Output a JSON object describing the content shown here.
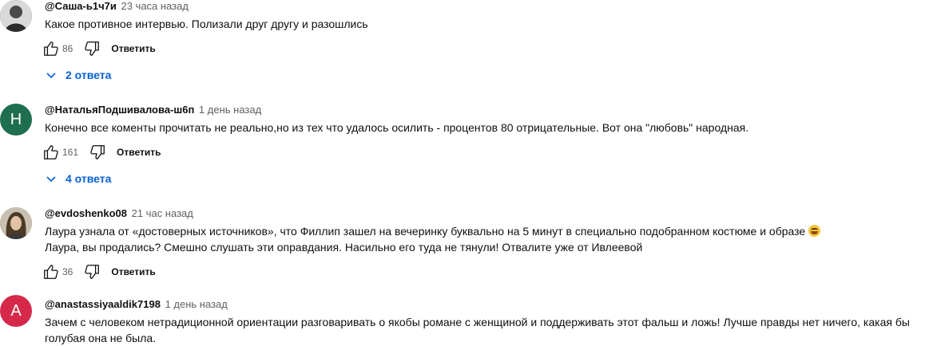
{
  "comments": [
    {
      "author": "@Саша-ь1ч7и",
      "time": "23 часа назад",
      "lines": [
        "Какое противное интервью. Полизали друг другу и разошлись"
      ],
      "likes": "86",
      "reply_label": "Ответить",
      "replies": "2 ответа",
      "avatar": {
        "type": "photo",
        "color": "#555555"
      }
    },
    {
      "author": "@НатальяПодшивалова-ш6п",
      "time": "1 день назад",
      "lines": [
        "Конечно все коменты прочитать не реально,но из тех что удалось осилить - процентов 80 отрицательные. Вот она \"любовь\" народная."
      ],
      "likes": "161",
      "reply_label": "Ответить",
      "replies": "4 ответа",
      "avatar": {
        "type": "letter",
        "letter": "Н",
        "color": "#1e6e4f"
      }
    },
    {
      "author": "@evdoshenko08",
      "time": "21 час назад",
      "lines": [
        "Лаура узнала от «достоверных источников», что Филлип зашел на вечеринку буквально на 5 минут в специально подобранном костюме и образе",
        "Лаура, вы продались? Смешно слушать эти оправдания. Насильно его туда не тянули! Отвалите уже от Ивлеевой"
      ],
      "likes": "36",
      "reply_label": "Ответить",
      "avatar": {
        "type": "photo",
        "color": "#7a6a4e"
      }
    },
    {
      "author": "@anastassiyaaldik7198",
      "time": "1 день назад",
      "lines": [
        "Зачем с человеком нетрадиционной ориентации разговаривать о якобы романе с женщиной и поддерживать этот фальш и ложь! Лучше правды нет ничего, какая бы",
        "голубая она не была."
      ],
      "avatar": {
        "type": "letter",
        "letter": "A",
        "color": "#d6294a"
      }
    }
  ],
  "icons": {
    "like": "thumb-up-icon",
    "dislike": "thumb-down-icon",
    "expand": "chevron-down-icon",
    "emoji": "laughing-emoji-icon"
  }
}
